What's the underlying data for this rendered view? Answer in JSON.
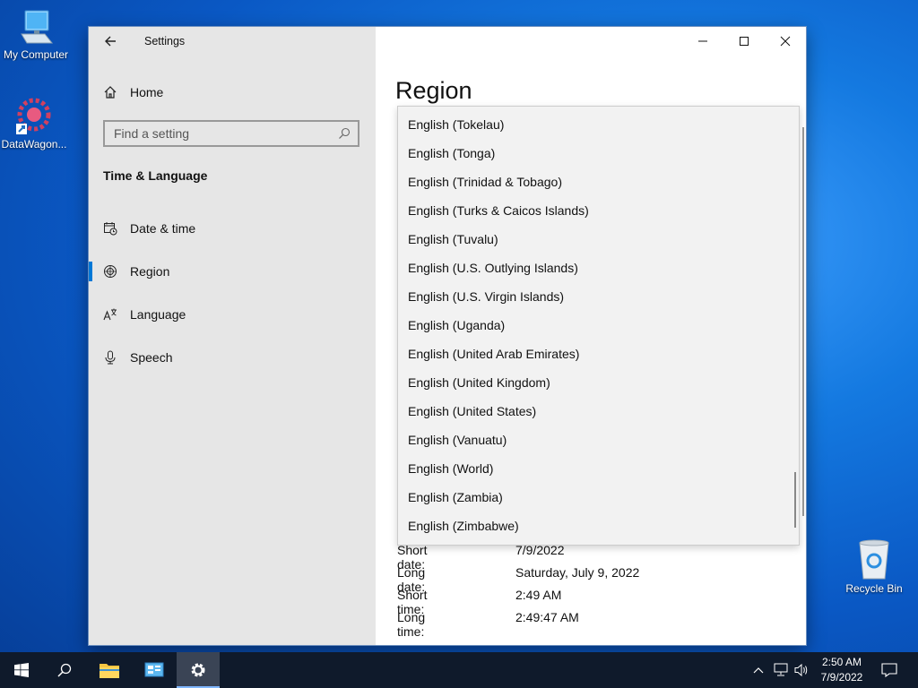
{
  "desktop": {
    "icons": [
      {
        "label": "My Computer"
      },
      {
        "label": "DataWagon..."
      },
      {
        "label": "Recycle Bin"
      }
    ]
  },
  "window": {
    "app_title": "Settings",
    "page_title": "Region",
    "home_label": "Home",
    "search_placeholder": "Find a setting",
    "section_title": "Time & Language",
    "nav": [
      {
        "label": "Date & time",
        "icon": "calendar-clock-icon"
      },
      {
        "label": "Region",
        "icon": "globe-icon",
        "active": true
      },
      {
        "label": "Language",
        "icon": "language-icon"
      },
      {
        "label": "Speech",
        "icon": "microphone-icon"
      }
    ],
    "region_dropdown": {
      "options": [
        "English (Tokelau)",
        "English (Tonga)",
        "English (Trinidad & Tobago)",
        "English (Turks & Caicos Islands)",
        "English (Tuvalu)",
        "English (U.S. Outlying Islands)",
        "English (U.S. Virgin Islands)",
        "English (Uganda)",
        "English (United Arab Emirates)",
        "English (United Kingdom)",
        "English (United States)",
        "English (Vanuatu)",
        "English (World)",
        "English (Zambia)",
        "English (Zimbabwe)"
      ]
    },
    "formats": [
      {
        "key": "Short date:",
        "value": "7/9/2022"
      },
      {
        "key": "Long date:",
        "value": "Saturday, July 9, 2022"
      },
      {
        "key": "Short time:",
        "value": "2:49 AM"
      },
      {
        "key": "Long time:",
        "value": "2:49:47 AM"
      }
    ]
  },
  "taskbar": {
    "time": "2:50 AM",
    "date": "7/9/2022"
  },
  "colors": {
    "accent": "#0078d7",
    "taskbar": "#0f1a2b",
    "sidebar": "#e6e6e6"
  }
}
